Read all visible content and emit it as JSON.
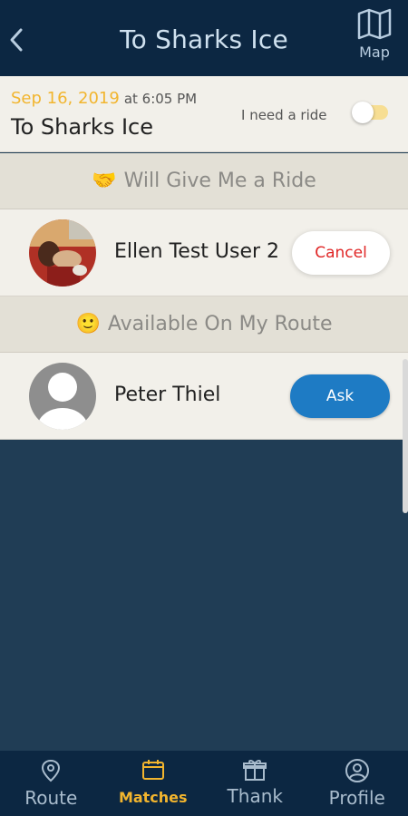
{
  "header": {
    "title": "To Sharks Ice",
    "map_label": "Map",
    "back_icon": "chevron-left-icon",
    "map_icon": "map-icon"
  },
  "trip": {
    "date": "Sep 16, 2019",
    "time_prefix": "at 6:05 PM",
    "title": "To Sharks Ice",
    "need_ride_label": "I need a ride",
    "need_ride_on": true
  },
  "sections": {
    "give_ride": {
      "emoji": "🤝",
      "label": "Will Give Me a Ride"
    },
    "available": {
      "emoji": "🙂",
      "label": "Available On My Route"
    }
  },
  "riders": [
    {
      "name": "Ellen Test User 2",
      "action_label": "Cancel"
    }
  ],
  "available": [
    {
      "name": "Peter Thiel",
      "action_label": "Ask"
    }
  ],
  "tabs": [
    {
      "label": "Route",
      "icon": "map-pin-icon",
      "active": false
    },
    {
      "label": "Matches",
      "icon": "calendar-icon",
      "active": true
    },
    {
      "label": "Thank",
      "icon": "gift-icon",
      "active": false
    },
    {
      "label": "Profile",
      "icon": "user-circle-icon",
      "active": false
    }
  ],
  "colors": {
    "header_bg": "#0c2742",
    "body_bg": "#203d55",
    "accent": "#f2b52e",
    "ask_blue": "#1e7bc4",
    "cancel_red": "#e02626"
  }
}
